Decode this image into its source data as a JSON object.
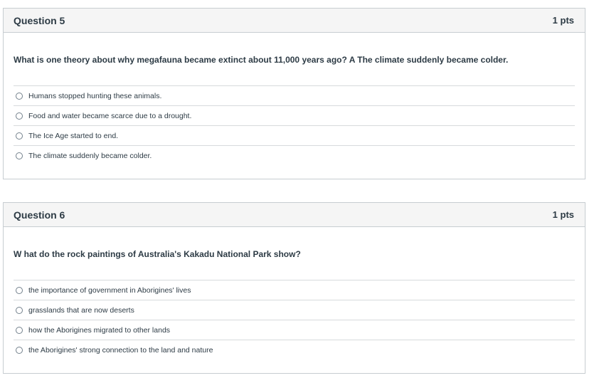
{
  "questions": [
    {
      "title": "Question 5",
      "points": "1 pts",
      "text": "What is one theory about why megafauna became extinct about 11,000 years ago?   A The climate suddenly became colder.",
      "answers": [
        "Humans stopped hunting these animals.",
        "Food and water became scarce due to a drought.",
        "The Ice Age started to end.",
        "The climate suddenly became colder."
      ]
    },
    {
      "title": "Question 6",
      "points": "1 pts",
      "text": "W hat do the rock paintings of Australia's Kakadu National Park show?",
      "answers": [
        "the importance of government in Aborigines' lives",
        "grasslands that are now deserts",
        "how the Aborigines migrated to other lands",
        "the Aborigines' strong connection to the land and nature"
      ]
    }
  ]
}
